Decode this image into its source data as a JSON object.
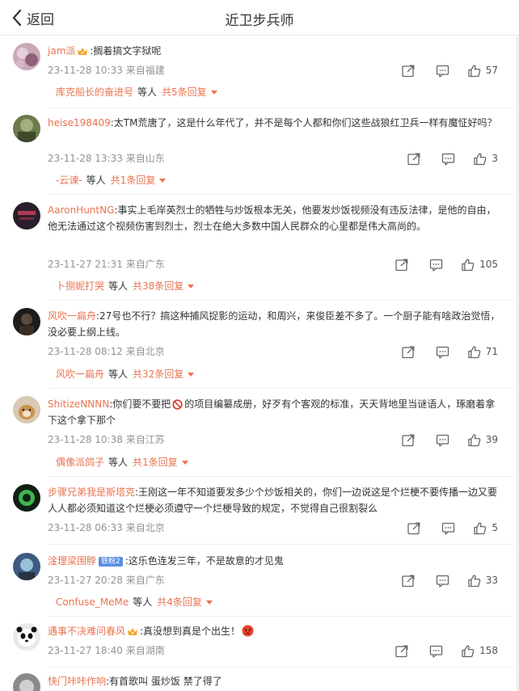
{
  "header": {
    "back_label": "返回",
    "title": "近卫步兵师"
  },
  "colors": {
    "accent": "#eb7350",
    "meta": "#939393",
    "text": "#333333"
  },
  "comments": [
    {
      "username": "jam派",
      "badge_icon": "crown-icon",
      "text": ":搁着搞文字狱呢",
      "time": "23-11-28 10:33",
      "location": "来自福建",
      "likes": "57",
      "replies": {
        "user": "库克船长的奋进号",
        "etc": "等人",
        "count": "共5条回复"
      }
    },
    {
      "username": "heise198409",
      "text": ":太TM荒唐了，这是什么年代了，并不是每个人都和你们这些战狼红卫兵一样有魔怔好吗？",
      "time": "23-11-28 13:33",
      "location": "来自山东",
      "likes": "3",
      "replies": {
        "user": "-云谏-",
        "etc": "等人",
        "count": "共1条回复"
      }
    },
    {
      "username": "AaronHuntNG",
      "text": ":事实上毛岸英烈士的牺牲与炒饭根本无关，他要发炒饭视频没有违反法律，是他的自由，他无法通过这个视频伤害到烈士，烈士在绝大多数中国人民群众的心里都是伟大高尚的。",
      "time": "23-11-27 21:31",
      "location": "来自广东",
      "likes": "105",
      "replies": {
        "user": "卜捌妮打哭",
        "etc": "等人",
        "count": "共38条回复"
      }
    },
    {
      "username": "风吹一扁舟",
      "text": ":27号也不行？搞这种捕风捉影的运动，和周兴，来俊臣差不多了。一个厨子能有啥政治觉悟，没必要上纲上线。",
      "time": "23-11-28 08:12",
      "location": "来自北京",
      "likes": "71",
      "replies": {
        "user": "风吹一扁舟",
        "etc": "等人",
        "count": "共32条回复"
      }
    },
    {
      "username": "ShitizeNNNN",
      "text_a": ":你们要不要把",
      "text_b": "的项目编纂成册，好歹有个客观的标准，天天背地里当谜语人，琢磨着拿下这个拿下那个",
      "time": "23-11-28 10:38",
      "location": "来自江苏",
      "likes": "39",
      "replies": {
        "user": "偶像派鸽子",
        "etc": "等人",
        "count": "共1条回复"
      }
    },
    {
      "username": "步骤兄弟我是斯塔克",
      "text": ":王刚这一年不知道要发多少个炒饭相关的，你们一边说这是个烂梗不要传播一边又要人人都必须知道这个烂梗必须遵守一个烂梗导致的规定，不觉得自己很割裂么",
      "time": "23-11-28 06:33",
      "location": "来自北京",
      "likes": "5"
    },
    {
      "username": "淦理梁围脖",
      "level_badge": "铁粉2",
      "text": ":这乐色连发三年，不是故意的才见鬼",
      "time": "23-11-27 20:28",
      "location": "来自广东",
      "likes": "33",
      "replies": {
        "user": "Confuse_MeMe",
        "etc": "等人",
        "count": "共4条回复"
      }
    },
    {
      "username": "遇事不决难问春风",
      "badge_icon": "crown-icon",
      "text": ":真没想到真是个出生！",
      "emoji": "angry-face-icon",
      "time": "23-11-27 18:40",
      "location": "来自湖南",
      "likes": "158"
    },
    {
      "username": "快门咔咔作响",
      "text": ":有首歌叫 蛋炒饭 禁了得了"
    }
  ]
}
